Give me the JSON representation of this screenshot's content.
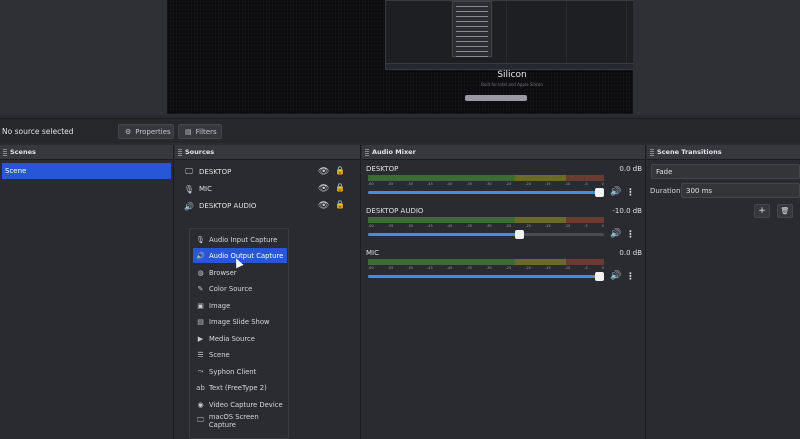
{
  "preview": {
    "silicon_title": "Silicon",
    "silicon_sub": "Built for Intel and Apple Silicon"
  },
  "properties_bar": {
    "status": "No source selected",
    "properties_label": "Properties",
    "filters_label": "Filters"
  },
  "docks": {
    "scenes_title": "Scenes",
    "sources_title": "Sources",
    "mixer_title": "Audio Mixer",
    "transitions_title": "Scene Transitions"
  },
  "scenes": [
    {
      "label": "Scene",
      "selected": true
    }
  ],
  "sources": [
    {
      "label": "DESKTOP",
      "icon": "monitor-icon"
    },
    {
      "label": "MIC",
      "icon": "microphone-icon"
    },
    {
      "label": "DESKTOP AUDIO",
      "icon": "speaker-icon"
    }
  ],
  "add_source_menu": [
    {
      "label": "Audio Input Capture",
      "icon": "microphone-icon"
    },
    {
      "label": "Audio Output Capture",
      "icon": "speaker-icon",
      "highlighted": true
    },
    {
      "label": "Browser",
      "icon": "globe-icon"
    },
    {
      "label": "Color Source",
      "icon": "paint-brush-icon"
    },
    {
      "label": "Image",
      "icon": "image-icon"
    },
    {
      "label": "Image Slide Show",
      "icon": "slideshow-icon"
    },
    {
      "label": "Media Source",
      "icon": "play-icon"
    },
    {
      "label": "Scene",
      "icon": "scene-icon"
    },
    {
      "label": "Syphon Client",
      "icon": "syphon-icon"
    },
    {
      "label": "Text (FreeType 2)",
      "icon": "text-icon"
    },
    {
      "label": "Video Capture Device",
      "icon": "camera-icon"
    },
    {
      "label": "macOS Screen Capture",
      "icon": "monitor-icon"
    }
  ],
  "mixer": {
    "tick_labels": [
      "-60",
      "-55",
      "-50",
      "-45",
      "-40",
      "-35",
      "-30",
      "-25",
      "-20",
      "-15",
      "-10",
      "-5",
      "0"
    ],
    "channels": [
      {
        "name": "DESKTOP",
        "db": "0.0 dB",
        "volume": 1.0,
        "level": 0.0
      },
      {
        "name": "DESKTOP AUDIO",
        "db": "-10.0 dB",
        "volume": 0.66,
        "level": 0.0
      },
      {
        "name": "MIC",
        "db": "0.0 dB",
        "volume": 1.0,
        "level": 0.0
      }
    ]
  },
  "transitions": {
    "type": "Fade",
    "duration_label": "Duration",
    "duration_value": "300 ms"
  },
  "colors": {
    "accent": "#2757d6",
    "volume": "#3f8fe8"
  }
}
